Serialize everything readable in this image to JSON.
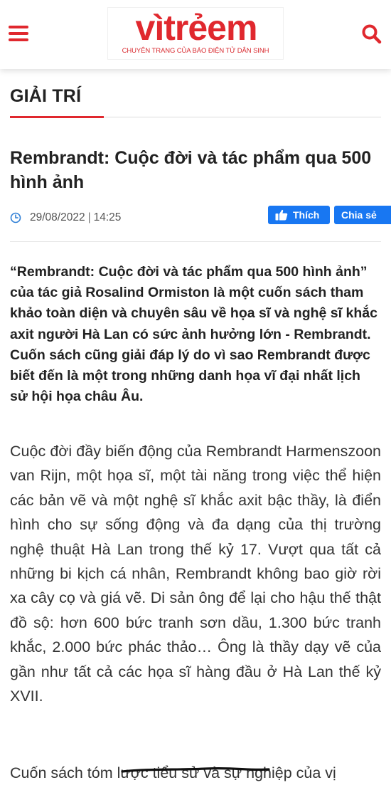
{
  "header": {
    "logo": {
      "word": "vìtrẻem",
      "tagline": "CHUYÊN TRANG CỦA BÁO ĐIỆN TỬ DÂN SINH"
    },
    "menu_icon": "hamburger-menu-icon",
    "search_icon": "search-icon",
    "accent_color": "#e0282e"
  },
  "section": {
    "title": "GIẢI TRÍ"
  },
  "article": {
    "title": "Rembrandt: Cuộc đời và tác phẩm qua 500 hình ảnh",
    "date": "29/08/2022",
    "time": "14:25",
    "sapo": "“Rembrandt: Cuộc đời và tác phẩm qua 500 hình ảnh” của tác giả Rosalind Ormiston là một cuốn sách tham khảo toàn diện và chuyên sâu về họa sĩ và nghệ sĩ khắc axit người Hà Lan có sức ảnh hưởng lớn - Rembrandt. Cuốn sách cũng giải đáp lý do vì sao Rembrandt được biết đến là một trong những danh họa vĩ đại nhất lịch sử hội họa châu Âu.",
    "paragraphs": [
      "Cuộc đời đầy biến động của Rembrandt Harmenszoon van Rijn, một họa sĩ, một tài năng trong việc thể hiện các bản vẽ và một nghệ sĩ khắc axit bậc thầy, là điển hình cho sự sống động và đa dạng của thị trường nghệ thuật Hà Lan trong thế kỷ 17. Vượt qua tất cả những bi kịch cá nhân, Rembrandt không bao giờ rời xa cây cọ và giá vẽ. Di sản ông để lại cho hậu thế thật đồ sộ: hơn 600 bức tranh sơn dầu, 1.300 bức tranh khắc, 2.000 bức phác thảo… Ông là thầy dạy vẽ của gần như tất cả các họa sĩ hàng đầu ở Hà Lan thế kỷ XVII.",
      "Cuốn sách tóm lược tiểu sử và sự nghiệp của vị"
    ]
  },
  "social": {
    "like_label": "Thích",
    "share_label": "Chia sẻ",
    "color": "#1877f2"
  }
}
